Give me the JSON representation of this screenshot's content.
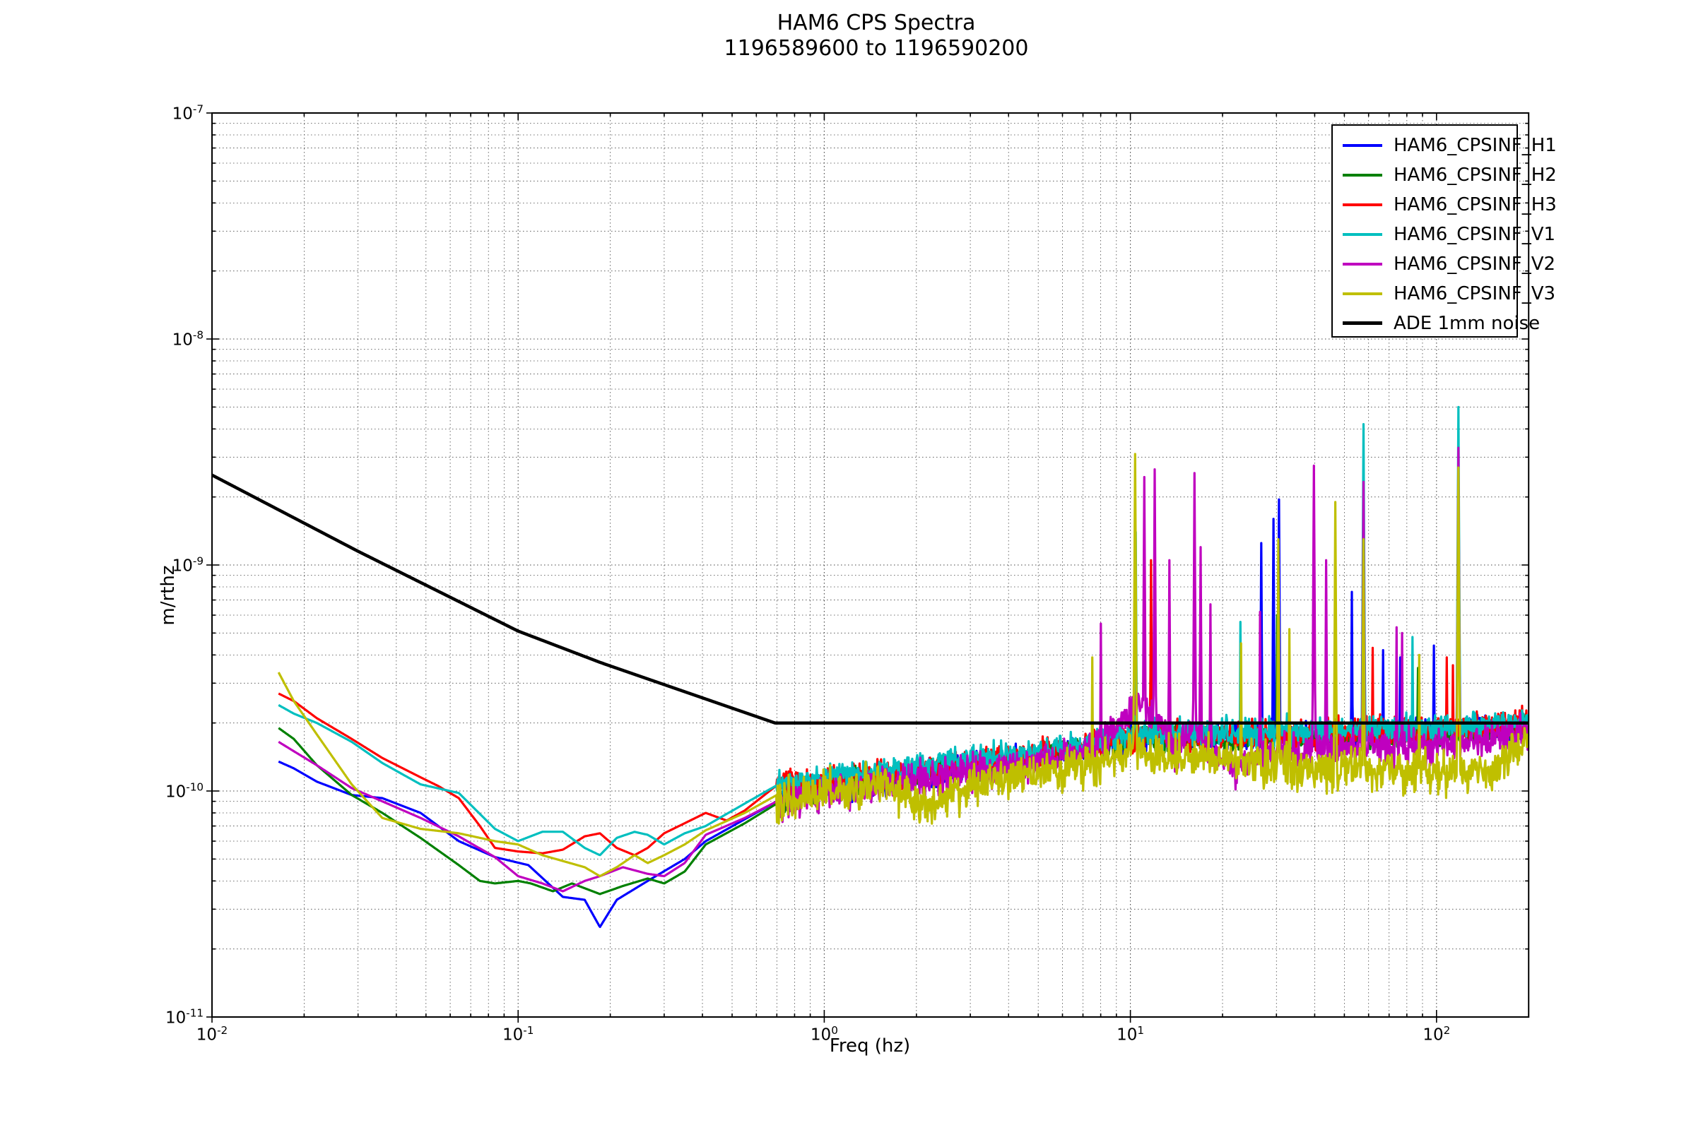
{
  "title": {
    "line1": "HAM6 CPS Spectra",
    "line2": "1196589600 to 1196590200"
  },
  "axes": {
    "xlabel": "Freq (hz)",
    "ylabel": "m/rthz",
    "xscale": "log",
    "yscale": "log",
    "xlim": [
      0.01,
      200
    ],
    "ylim": [
      1e-11,
      1e-07
    ],
    "x_ticks": [
      {
        "mantissa": "10",
        "exp": "-2",
        "log": -2
      },
      {
        "mantissa": "10",
        "exp": "-1",
        "log": -1
      },
      {
        "mantissa": "10",
        "exp": "0",
        "log": 0
      },
      {
        "mantissa": "10",
        "exp": "1",
        "log": 1
      },
      {
        "mantissa": "10",
        "exp": "2",
        "log": 2
      }
    ],
    "y_ticks": [
      {
        "mantissa": "10",
        "exp": "-7",
        "log": -7
      },
      {
        "mantissa": "10",
        "exp": "-8",
        "log": -8
      },
      {
        "mantissa": "10",
        "exp": "-9",
        "log": -9
      },
      {
        "mantissa": "10",
        "exp": "-10",
        "log": -10
      },
      {
        "mantissa": "10",
        "exp": "-11",
        "log": -11
      }
    ],
    "grid": "both-dotted"
  },
  "legend": {
    "position": "upper-right",
    "entries": [
      {
        "label": "HAM6_CPSINF_H1",
        "color": "#0000ff"
      },
      {
        "label": "HAM6_CPSINF_H2",
        "color": "#008000"
      },
      {
        "label": "HAM6_CPSINF_H3",
        "color": "#ff0000"
      },
      {
        "label": "HAM6_CPSINF_V1",
        "color": "#00bfbf"
      },
      {
        "label": "HAM6_CPSINF_V2",
        "color": "#bf00bf"
      },
      {
        "label": "HAM6_CPSINF_V3",
        "color": "#bfbf00"
      },
      {
        "label": "ADE 1mm noise",
        "color": "#000000"
      }
    ]
  },
  "chart_data": {
    "type": "line",
    "title": "HAM6 CPS Spectra 1196589600 to 1196590200",
    "xlabel": "Freq (hz)",
    "ylabel": "m/rthz",
    "xscale": "log",
    "yscale": "log",
    "xlim": [
      0.01,
      200
    ],
    "ylim": [
      1e-11,
      1e-07
    ],
    "legend_position": "upper-right",
    "series": [
      {
        "name": "HAM6_CPSINF_H1",
        "color": "#0000ff",
        "width": 3.2,
        "seed": 11,
        "noise": {
          "from": 0.7,
          "dex": 0.055,
          "bias": 0
        },
        "base": [
          [
            0.0165,
            1.35e-10
          ],
          [
            0.0185,
            1.26e-10
          ],
          [
            0.022,
            1.1e-10
          ],
          [
            0.0286,
            9.6e-11
          ],
          [
            0.036,
            9.3e-11
          ],
          [
            0.048,
            8e-11
          ],
          [
            0.064,
            6e-11
          ],
          [
            0.084,
            5.1e-11
          ],
          [
            0.108,
            4.7e-11
          ],
          [
            0.14,
            3.4e-11
          ],
          [
            0.165,
            3.3e-11
          ],
          [
            0.185,
            2.5e-11
          ],
          [
            0.21,
            3.3e-11
          ],
          [
            0.265,
            4e-11
          ],
          [
            0.35,
            5e-11
          ],
          [
            0.41,
            6e-11
          ],
          [
            0.55,
            7.5e-11
          ],
          [
            0.7,
            9e-11
          ],
          [
            1.0,
            1.05e-10
          ],
          [
            2.0,
            1.15e-10
          ],
          [
            4.0,
            1.35e-10
          ],
          [
            7.0,
            1.5e-10
          ],
          [
            10.0,
            1.7e-10
          ],
          [
            20.0,
            1.75e-10
          ],
          [
            50.0,
            1.8e-10
          ],
          [
            100.0,
            1.85e-10
          ],
          [
            200.0,
            1.95e-10
          ]
        ],
        "spikes": [
          [
            26.8,
            1.25e-09
          ],
          [
            29.4,
            1.6e-09
          ],
          [
            30.6,
            1.95e-09
          ],
          [
            52.8,
            7.6e-10
          ],
          [
            67.0,
            4.2e-10
          ],
          [
            76.0,
            3.9e-10
          ],
          [
            98.0,
            4.4e-10
          ]
        ]
      },
      {
        "name": "HAM6_CPSINF_H2",
        "color": "#008000",
        "width": 3.2,
        "seed": 22,
        "noise": {
          "from": 0.7,
          "dex": 0.05,
          "bias": 0
        },
        "base": [
          [
            0.0165,
            1.9e-10
          ],
          [
            0.0185,
            1.7e-10
          ],
          [
            0.022,
            1.3e-10
          ],
          [
            0.0286,
            9.6e-11
          ],
          [
            0.036,
            8e-11
          ],
          [
            0.048,
            6.2e-11
          ],
          [
            0.064,
            4.7e-11
          ],
          [
            0.075,
            4e-11
          ],
          [
            0.084,
            3.9e-11
          ],
          [
            0.1,
            4e-11
          ],
          [
            0.11,
            3.9e-11
          ],
          [
            0.13,
            3.6e-11
          ],
          [
            0.15,
            3.9e-11
          ],
          [
            0.185,
            3.5e-11
          ],
          [
            0.22,
            3.8e-11
          ],
          [
            0.265,
            4.1e-11
          ],
          [
            0.3,
            3.9e-11
          ],
          [
            0.35,
            4.4e-11
          ],
          [
            0.41,
            5.8e-11
          ],
          [
            0.55,
            7.2e-11
          ],
          [
            0.7,
            8.8e-11
          ],
          [
            1.0,
            1.05e-10
          ],
          [
            2.0,
            1.2e-10
          ],
          [
            4.0,
            1.35e-10
          ],
          [
            7.0,
            1.55e-10
          ],
          [
            10.0,
            1.7e-10
          ],
          [
            20.0,
            1.7e-10
          ],
          [
            50.0,
            1.75e-10
          ],
          [
            100.0,
            1.8e-10
          ],
          [
            200.0,
            1.9e-10
          ]
        ],
        "spikes": [
          [
            30.2,
            6e-10
          ],
          [
            57.8,
            6e-10
          ],
          [
            87.0,
            3.5e-10
          ]
        ]
      },
      {
        "name": "HAM6_CPSINF_H3",
        "color": "#ff0000",
        "width": 3.2,
        "seed": 33,
        "noise": {
          "from": 0.7,
          "dex": 0.06,
          "bias": 0
        },
        "base": [
          [
            0.0165,
            2.7e-10
          ],
          [
            0.0185,
            2.5e-10
          ],
          [
            0.022,
            2.1e-10
          ],
          [
            0.0286,
            1.7e-10
          ],
          [
            0.036,
            1.4e-10
          ],
          [
            0.048,
            1.15e-10
          ],
          [
            0.055,
            1.05e-10
          ],
          [
            0.064,
            9.3e-11
          ],
          [
            0.075,
            7e-11
          ],
          [
            0.084,
            5.6e-11
          ],
          [
            0.1,
            5.4e-11
          ],
          [
            0.12,
            5.3e-11
          ],
          [
            0.14,
            5.5e-11
          ],
          [
            0.165,
            6.3e-11
          ],
          [
            0.185,
            6.5e-11
          ],
          [
            0.21,
            5.6e-11
          ],
          [
            0.24,
            5.2e-11
          ],
          [
            0.265,
            5.6e-11
          ],
          [
            0.3,
            6.5e-11
          ],
          [
            0.35,
            7.2e-11
          ],
          [
            0.41,
            8e-11
          ],
          [
            0.48,
            7.4e-11
          ],
          [
            0.55,
            8.2e-11
          ],
          [
            0.7,
            1.06e-10
          ],
          [
            1.0,
            1.1e-10
          ],
          [
            2.0,
            1.2e-10
          ],
          [
            4.0,
            1.4e-10
          ],
          [
            7.0,
            1.55e-10
          ],
          [
            10.0,
            1.75e-10
          ],
          [
            20.0,
            1.75e-10
          ],
          [
            50.0,
            1.8e-10
          ],
          [
            100.0,
            1.85e-10
          ],
          [
            200.0,
            2e-10
          ]
        ],
        "spikes": [
          [
            11.7,
            1.05e-09
          ],
          [
            62.0,
            4.3e-10
          ],
          [
            108.0,
            3.9e-10
          ],
          [
            113.0,
            3.6e-10
          ]
        ]
      },
      {
        "name": "HAM6_CPSINF_V1",
        "color": "#00bfbf",
        "width": 3.2,
        "seed": 44,
        "noise": {
          "from": 0.7,
          "dex": 0.055,
          "bias": 0
        },
        "base": [
          [
            0.0165,
            2.4e-10
          ],
          [
            0.0185,
            2.2e-10
          ],
          [
            0.022,
            2e-10
          ],
          [
            0.0286,
            1.65e-10
          ],
          [
            0.036,
            1.33e-10
          ],
          [
            0.048,
            1.07e-10
          ],
          [
            0.064,
            9.8e-11
          ],
          [
            0.084,
            6.8e-11
          ],
          [
            0.1,
            6e-11
          ],
          [
            0.12,
            6.6e-11
          ],
          [
            0.14,
            6.6e-11
          ],
          [
            0.165,
            5.6e-11
          ],
          [
            0.185,
            5.2e-11
          ],
          [
            0.21,
            6.2e-11
          ],
          [
            0.24,
            6.6e-11
          ],
          [
            0.265,
            6.4e-11
          ],
          [
            0.3,
            5.8e-11
          ],
          [
            0.35,
            6.5e-11
          ],
          [
            0.41,
            7e-11
          ],
          [
            0.55,
            8.8e-11
          ],
          [
            0.7,
            1.06e-10
          ],
          [
            1.0,
            1.15e-10
          ],
          [
            2.0,
            1.3e-10
          ],
          [
            4.0,
            1.45e-10
          ],
          [
            7.0,
            1.6e-10
          ],
          [
            10.0,
            1.8e-10
          ],
          [
            20.0,
            1.85e-10
          ],
          [
            50.0,
            1.85e-10
          ],
          [
            100.0,
            1.9e-10
          ],
          [
            200.0,
            2e-10
          ]
        ],
        "spikes": [
          [
            10.4,
            1.4e-09
          ],
          [
            22.9,
            5.6e-10
          ],
          [
            57.8,
            4.2e-09
          ],
          [
            83.5,
            4.8e-10
          ],
          [
            118.0,
            5e-09
          ]
        ]
      },
      {
        "name": "HAM6_CPSINF_V2",
        "color": "#bf00bf",
        "width": 3.2,
        "seed": 55,
        "noise": {
          "from": 0.7,
          "dex": 0.07,
          "bias": -0.01
        },
        "base": [
          [
            0.0165,
            1.65e-10
          ],
          [
            0.0185,
            1.5e-10
          ],
          [
            0.022,
            1.3e-10
          ],
          [
            0.0286,
            1.03e-10
          ],
          [
            0.036,
            9e-11
          ],
          [
            0.048,
            7.6e-11
          ],
          [
            0.064,
            6.3e-11
          ],
          [
            0.084,
            5.1e-11
          ],
          [
            0.1,
            4.2e-11
          ],
          [
            0.12,
            3.9e-11
          ],
          [
            0.14,
            3.6e-11
          ],
          [
            0.165,
            4e-11
          ],
          [
            0.185,
            4.2e-11
          ],
          [
            0.22,
            4.6e-11
          ],
          [
            0.265,
            4.3e-11
          ],
          [
            0.3,
            4.2e-11
          ],
          [
            0.35,
            4.8e-11
          ],
          [
            0.41,
            6.4e-11
          ],
          [
            0.55,
            7.6e-11
          ],
          [
            0.7,
            9e-11
          ],
          [
            1.0,
            1e-10
          ],
          [
            2.0,
            1.15e-10
          ],
          [
            4.0,
            1.3e-10
          ],
          [
            7.0,
            1.5e-10
          ],
          [
            9.0,
            1.9e-10
          ],
          [
            10.5,
            2.5e-10
          ],
          [
            12.0,
            2.3e-10
          ],
          [
            14.0,
            1.5e-10
          ],
          [
            16.0,
            2e-10
          ],
          [
            18.0,
            1.5e-10
          ],
          [
            22.0,
            1.3e-10
          ],
          [
            30.0,
            1.5e-10
          ],
          [
            50.0,
            1.6e-10
          ],
          [
            100.0,
            1.6e-10
          ],
          [
            200.0,
            1.85e-10
          ]
        ],
        "spikes": [
          [
            8.0,
            5.5e-10
          ],
          [
            11.1,
            2.45e-09
          ],
          [
            12.0,
            2.65e-09
          ],
          [
            13.4,
            1.05e-09
          ],
          [
            16.2,
            2.55e-09
          ],
          [
            17.0,
            1.2e-09
          ],
          [
            18.3,
            6.7e-10
          ],
          [
            26.5,
            6.2e-10
          ],
          [
            39.8,
            2.75e-09
          ],
          [
            43.5,
            1.05e-09
          ],
          [
            57.8,
            2.33e-09
          ],
          [
            74.0,
            5.3e-10
          ],
          [
            77.0,
            5e-10
          ],
          [
            118.0,
            3.3e-09
          ]
        ]
      },
      {
        "name": "HAM6_CPSINF_V3",
        "color": "#bfbf00",
        "width": 3.2,
        "seed": 66,
        "noise": {
          "from": 0.7,
          "dex": 0.085,
          "bias": -0.02
        },
        "base": [
          [
            0.0165,
            3.35e-10
          ],
          [
            0.0185,
            2.5e-10
          ],
          [
            0.022,
            1.78e-10
          ],
          [
            0.0286,
            1.07e-10
          ],
          [
            0.036,
            7.6e-11
          ],
          [
            0.048,
            6.8e-11
          ],
          [
            0.064,
            6.5e-11
          ],
          [
            0.084,
            6e-11
          ],
          [
            0.1,
            5.8e-11
          ],
          [
            0.12,
            5.2e-11
          ],
          [
            0.14,
            4.9e-11
          ],
          [
            0.165,
            4.6e-11
          ],
          [
            0.185,
            4.2e-11
          ],
          [
            0.21,
            4.6e-11
          ],
          [
            0.24,
            5.2e-11
          ],
          [
            0.265,
            4.8e-11
          ],
          [
            0.3,
            5.2e-11
          ],
          [
            0.35,
            5.8e-11
          ],
          [
            0.41,
            6.7e-11
          ],
          [
            0.55,
            8e-11
          ],
          [
            0.7,
            9.6e-11
          ],
          [
            1.0,
            1.05e-10
          ],
          [
            1.6,
            1.1e-10
          ],
          [
            2.2,
            9e-11
          ],
          [
            3.0,
            1.1e-10
          ],
          [
            4.0,
            1.2e-10
          ],
          [
            6.0,
            1.3e-10
          ],
          [
            8.0,
            1.4e-10
          ],
          [
            10.0,
            1.6e-10
          ],
          [
            13.0,
            1.5e-10
          ],
          [
            20.0,
            1.45e-10
          ],
          [
            35.0,
            1.3e-10
          ],
          [
            60.0,
            1.3e-10
          ],
          [
            100.0,
            1.25e-10
          ],
          [
            150.0,
            1.3e-10
          ],
          [
            200.0,
            1.75e-10
          ]
        ],
        "spikes": [
          [
            7.5,
            3.9e-10
          ],
          [
            10.35,
            3.1e-09
          ],
          [
            23.0,
            4.5e-10
          ],
          [
            30.5,
            1.3e-09
          ],
          [
            33.0,
            5.2e-10
          ],
          [
            46.8,
            1.9e-09
          ],
          [
            57.8,
            1.3e-09
          ],
          [
            88.0,
            4e-10
          ],
          [
            118.0,
            2.7e-09
          ]
        ]
      },
      {
        "name": "ADE 1mm noise",
        "color": "#000000",
        "width": 4.5,
        "seed": 1,
        "noise": null,
        "base": [
          [
            0.01,
            2.5e-09
          ],
          [
            0.03,
            1.15e-09
          ],
          [
            0.1,
            5.1e-10
          ],
          [
            0.186,
            3.7e-10
          ],
          [
            0.69,
            2e-10
          ],
          [
            200.0,
            2e-10
          ]
        ],
        "spikes": []
      }
    ]
  }
}
